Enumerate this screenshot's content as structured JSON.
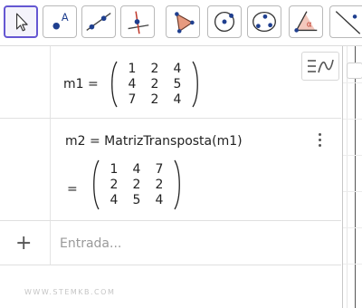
{
  "toolbar": {
    "tools": [
      {
        "name": "move-tool"
      },
      {
        "name": "point-tool"
      },
      {
        "name": "line-tool"
      },
      {
        "name": "perpendicular-line-tool"
      },
      {
        "name": "polygon-tool"
      },
      {
        "name": "circle-center-point-tool"
      },
      {
        "name": "conic-tool"
      },
      {
        "name": "angle-tool"
      },
      {
        "name": "reflect-tool"
      }
    ],
    "angle_symbol": "α",
    "point_label": "A"
  },
  "algebra": {
    "row1": {
      "lhs": "m1 =",
      "matrix": [
        [
          "1",
          "2",
          "4"
        ],
        [
          "4",
          "2",
          "5"
        ],
        [
          "7",
          "2",
          "4"
        ]
      ]
    },
    "row2": {
      "definition": "m2 = MatrizTransposta(m1)",
      "eq": "=",
      "matrix": [
        [
          "1",
          "4",
          "7"
        ],
        [
          "2",
          "2",
          "2"
        ],
        [
          "4",
          "5",
          "4"
        ]
      ]
    },
    "input": {
      "plus": "+",
      "placeholder": "Entrada..."
    },
    "watermark": "WWW.STEMKB.COM"
  }
}
